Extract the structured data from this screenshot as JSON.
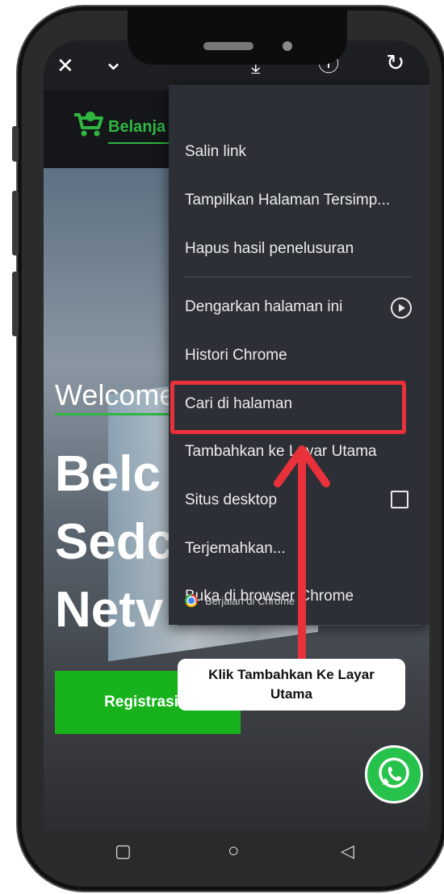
{
  "browser": {
    "close_glyph": "✕",
    "tabs_glyph": "⌄",
    "reload_glyph": "↻",
    "download_glyph": "⤓",
    "info_glyph": "ⓘ"
  },
  "site": {
    "logo_text": "Belanja",
    "welcome": "Welcome",
    "headline": [
      "Belc",
      "Sedc",
      "Netv"
    ],
    "register_button": "Registrasi"
  },
  "menu": {
    "items": [
      "Salin link",
      "Tampilkan Halaman Tersimp...",
      "Hapus hasil penelusuran",
      "Dengarkan halaman ini",
      "Histori Chrome",
      "Cari di halaman",
      "Tambahkan ke Layar Utama",
      "Situs desktop",
      "Terjemahkan...",
      "Buka di browser Chrome"
    ],
    "footer": "Berjalan di Chrome"
  },
  "annotation": {
    "callout_line1": "Klik Tambahkan Ke Layar",
    "callout_line2": "Utama",
    "highlight_color": "#e8313a"
  },
  "navbar": {
    "square_glyph": "▢",
    "circle_glyph": "○",
    "back_glyph": "◁"
  },
  "icons": [
    "close-icon",
    "chevron-down-icon",
    "download-icon",
    "info-icon",
    "reload-icon",
    "play-circle-icon",
    "checkbox-icon",
    "chrome-icon",
    "whatsapp-icon",
    "cart-icon"
  ]
}
